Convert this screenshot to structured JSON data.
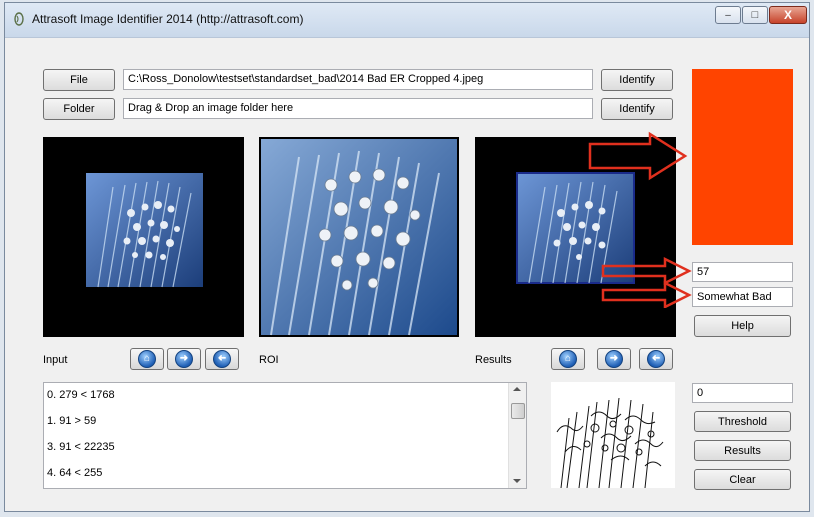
{
  "window": {
    "title": "Attrasoft Image Identifier 2014 (http://attrasoft.com)",
    "minimize_label": "–",
    "maximize_label": "□",
    "close_label": "X"
  },
  "file_row": {
    "button_label": "File",
    "path_value": "C:\\Ross_Donolow\\testset\\standardset_bad\\2014 Bad ER Cropped 4.jpeg",
    "identify_label": "Identify"
  },
  "folder_row": {
    "button_label": "Folder",
    "path_value": "Drag & Drop an image folder here",
    "identify_label": "Identify"
  },
  "labels": {
    "input": "Input",
    "roi": "ROI",
    "results": "Results"
  },
  "result_panel": {
    "color_swatch": "#ff4400",
    "score_value": "57",
    "classification_value": "Somewhat Bad",
    "help_label": "Help"
  },
  "list": {
    "items": [
      "0. 279 < 1768",
      "1. 91 > 59",
      "3. 91 < 22235",
      "4. 64 < 255"
    ]
  },
  "threshold": {
    "value": "0",
    "threshold_label": "Threshold",
    "results_label": "Results",
    "clear_label": "Clear"
  },
  "icons": {
    "nav_home": "home-icon",
    "nav_next": "arrow-right-icon",
    "nav_prev": "arrow-left-icon"
  },
  "colors": {
    "annotation_arrows": "#e0301e"
  }
}
